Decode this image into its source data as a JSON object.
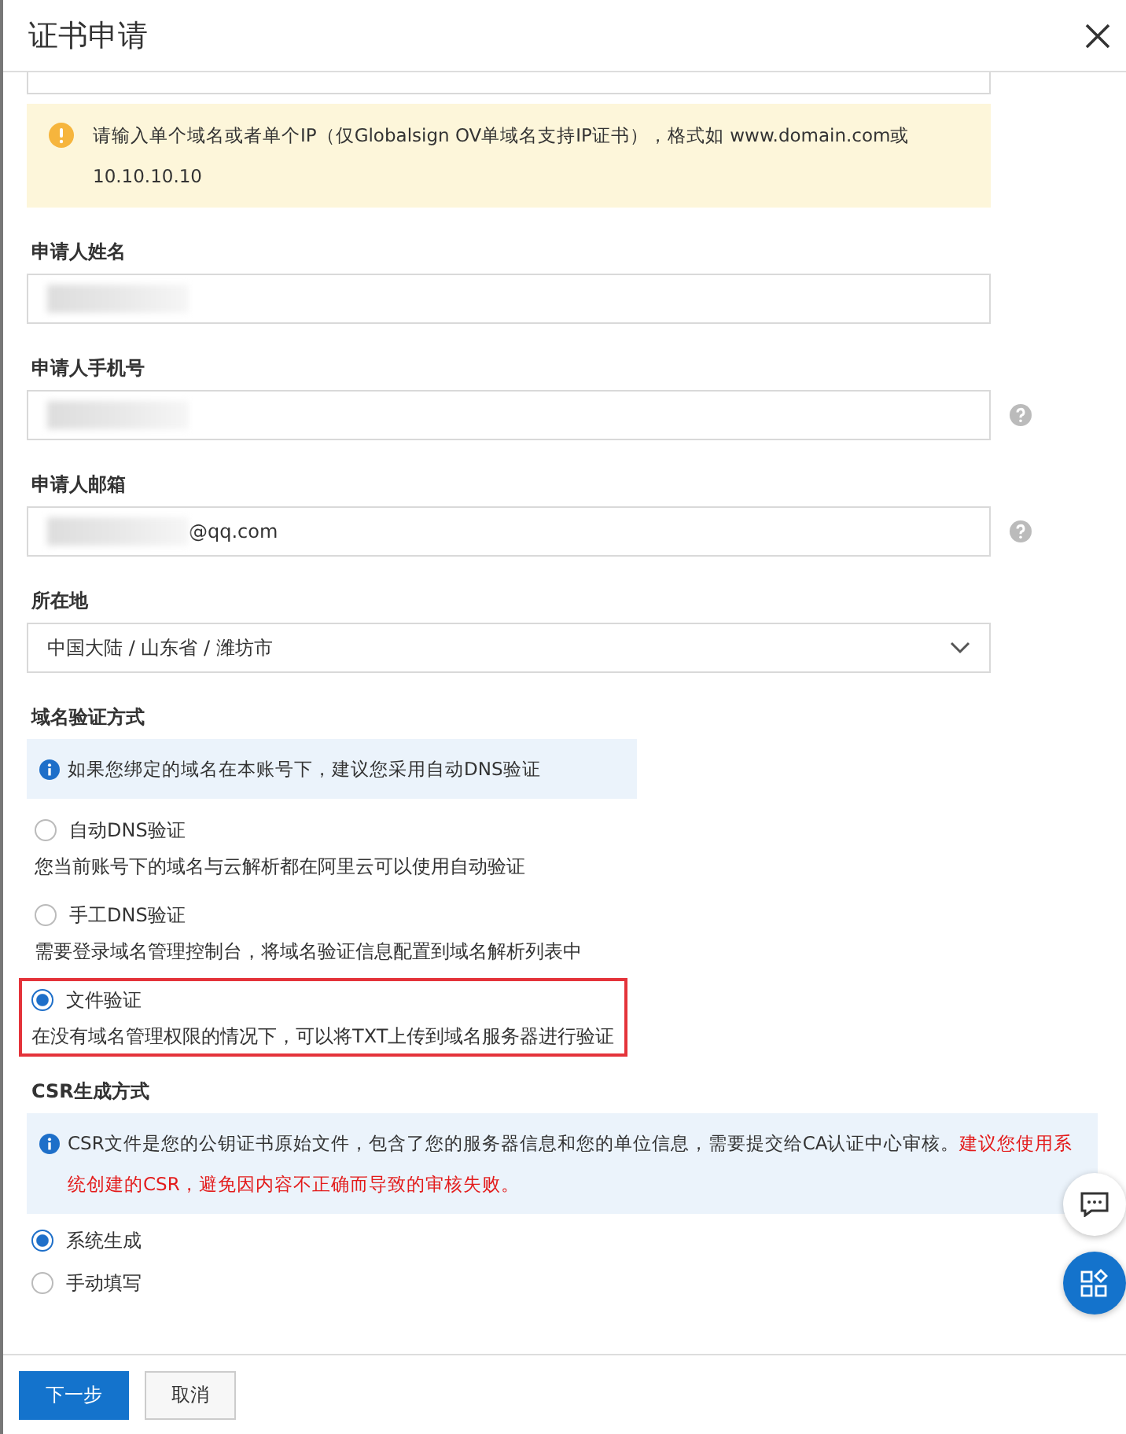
{
  "dialog": {
    "title": "证书申请"
  },
  "domain_hint": "请输入单个域名或者单个IP（仅Globalsign OV单域名支持IP证书），格式如 www.domain.com或10.10.10.10",
  "fields": [
    {
      "label": "申请人姓名",
      "redacted": true,
      "help": false
    },
    {
      "label": "申请人手机号",
      "redacted": true,
      "help": true
    },
    {
      "label": "申请人邮箱",
      "value": "@qq.com",
      "redacted": true,
      "help": true
    }
  ],
  "location": {
    "label": "所在地",
    "value": "中国大陆 / 山东省 / 潍坊市"
  },
  "domain_verification": {
    "label": "域名验证方式",
    "notice": "如果您绑定的域名在本账号下，建议您采用自动DNS验证",
    "options": [
      {
        "label": "自动DNS验证",
        "description": "您当前账号下的域名与云解析都在阿里云可以使用自动验证",
        "selected": false,
        "highlighted": false
      },
      {
        "label": "手工DNS验证",
        "description": "需要登录域名管理控制台，将域名验证信息配置到域名解析列表中",
        "selected": false,
        "highlighted": false
      },
      {
        "label": "文件验证",
        "description": "在没有域名管理权限的情况下，可以将TXT上传到域名服务器进行验证",
        "selected": true,
        "highlighted": true
      }
    ]
  },
  "csr": {
    "label": "CSR生成方式",
    "notice": "CSR文件是您的公钥证书原始文件，包含了您的服务器信息和您的单位信息，需要提交给CA认证中心审核。",
    "notice_warning": "建议您使用系统创建的CSR，避免因内容不正确而导致的审核失败。",
    "options": [
      {
        "label": "系统生成",
        "selected": true
      },
      {
        "label": "手动填写",
        "selected": false
      }
    ]
  },
  "buttons": [
    {
      "label": "下一步",
      "kind": "primary"
    },
    {
      "label": "取消",
      "kind": "secondary"
    }
  ]
}
